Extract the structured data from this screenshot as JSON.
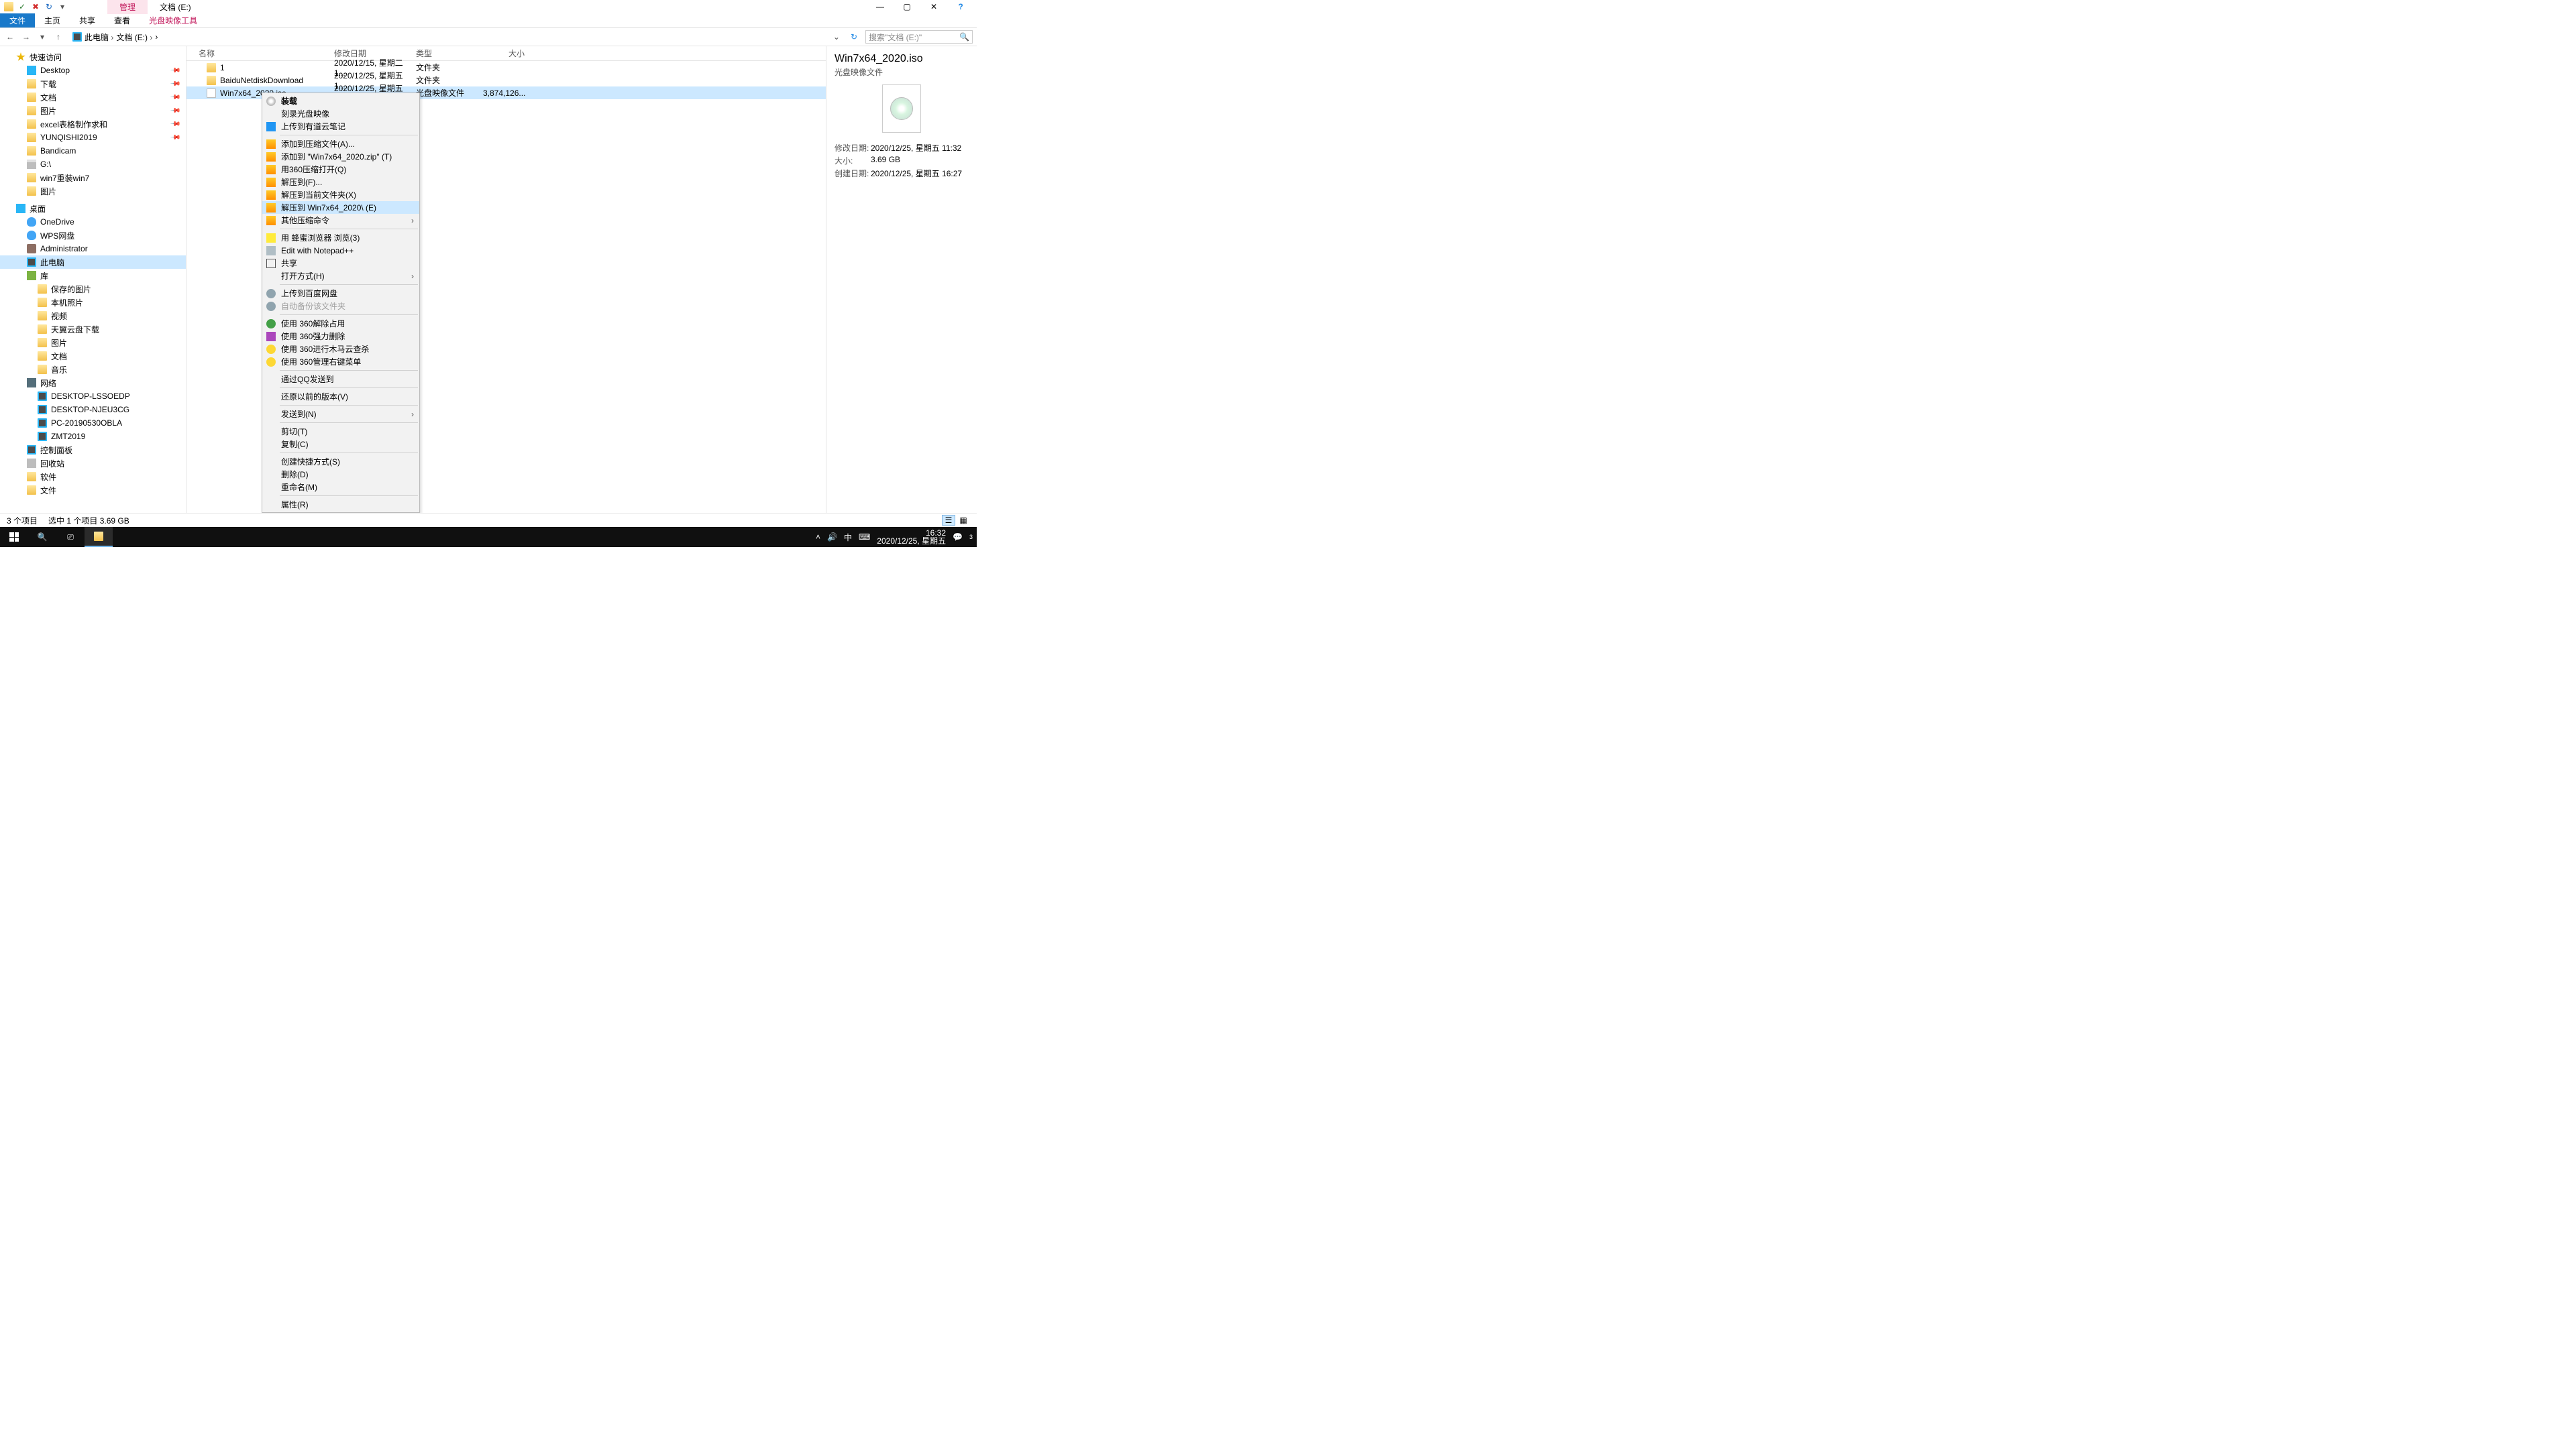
{
  "qat": {
    "save_glyph": "✓",
    "delete_glyph": "✖",
    "redo_glyph": "↻",
    "dd_glyph": "▾"
  },
  "title": {
    "tools_tab": "管理",
    "doc_title": "文档 (E:)"
  },
  "win": {
    "min": "—",
    "max": "▢",
    "close": "✕",
    "help": "?"
  },
  "ribbon": {
    "file": "文件",
    "home": "主页",
    "share": "共享",
    "view": "查看",
    "iso_tools": "光盘映像工具"
  },
  "nav": {
    "back": "←",
    "fwd": "→",
    "dd": "▾",
    "up": "↑",
    "refresh": "↻",
    "addr_dd": "⌄",
    "crumbs": [
      "此电脑",
      "文档 (E:)"
    ],
    "search_ph": "搜索\"文档 (E:)\"",
    "search_glyph": "🔍"
  },
  "sidebar": {
    "quick": "快速访问",
    "q_items": [
      "Desktop",
      "下载",
      "文档",
      "图片",
      "excel表格制作求和",
      "YUNQISHI2019",
      "Bandicam",
      "G:\\",
      "win7重装win7",
      "图片"
    ],
    "desktop_grp": "桌面",
    "d_items": [
      "OneDrive",
      "WPS网盘",
      "Administrator",
      "此电脑",
      "库"
    ],
    "lib_items": [
      "保存的图片",
      "本机照片",
      "视频",
      "天翼云盘下载",
      "图片",
      "文档",
      "音乐"
    ],
    "net": "网络",
    "net_items": [
      "DESKTOP-LSSOEDP",
      "DESKTOP-NJEU3CG",
      "PC-20190530OBLA",
      "ZMT2019"
    ],
    "tail": [
      "控制面板",
      "回收站",
      "软件",
      "文件"
    ]
  },
  "headers": {
    "name": "名称",
    "date": "修改日期",
    "type": "类型",
    "size": "大小"
  },
  "rows": [
    {
      "name": "1",
      "date": "2020/12/15, 星期二 1...",
      "type": "文件夹",
      "size": ""
    },
    {
      "name": "BaiduNetdiskDownload",
      "date": "2020/12/25, 星期五 1...",
      "type": "文件夹",
      "size": ""
    },
    {
      "name": "Win7x64_2020.iso",
      "date": "2020/12/25, 星期五 1...",
      "type": "光盘映像文件",
      "size": "3,874,126..."
    }
  ],
  "ctx": {
    "mount": "装载",
    "burn": "刻录光盘映像",
    "youdao": "上传到有道云笔记",
    "add_arc": "添加到压缩文件(A)...",
    "add_zip": "添加到 \"Win7x64_2020.zip\" (T)",
    "open360": "用360压缩打开(Q)",
    "extract_to": "解压到(F)...",
    "extract_here": "解压到当前文件夹(X)",
    "extract_named": "解压到 Win7x64_2020\\ (E)",
    "other_arc": "其他压缩命令",
    "bee": "用 蜂蜜浏览器 浏览(3)",
    "npp": "Edit with Notepad++",
    "share": "共享",
    "open_with": "打开方式(H)",
    "baidu_up": "上传到百度网盘",
    "baidu_bak": "自动备份该文件夹",
    "s360_unlock": "使用 360解除占用",
    "s360_fdel": "使用 360强力删除",
    "s360_scan": "使用 360进行木马云查杀",
    "s360_mgr": "使用 360管理右键菜单",
    "qq_send": "通过QQ发送到",
    "restore": "还原以前的版本(V)",
    "send_to": "发送到(N)",
    "cut": "剪切(T)",
    "copy": "复制(C)",
    "shortcut": "创建快捷方式(S)",
    "delete": "删除(D)",
    "rename": "重命名(M)",
    "props": "属性(R)",
    "arrow": "›"
  },
  "preview": {
    "title": "Win7x64_2020.iso",
    "subtitle": "光盘映像文件",
    "rows": {
      "mdate_k": "修改日期:",
      "mdate_v": "2020/12/25, 星期五 11:32",
      "size_k": "大小:",
      "size_v": "3.69 GB",
      "cdate_k": "创建日期:",
      "cdate_v": "2020/12/25, 星期五 16:27"
    }
  },
  "status": {
    "count": "3 个项目",
    "selected": "选中 1 个项目  3.69 GB"
  },
  "taskbar": {
    "tray_chevron": "˄",
    "tray_vol": "🔊",
    "tray_ime": "中",
    "tray_kb": "⌨",
    "tray_bubble": "💬",
    "badge": "3",
    "time": "16:32",
    "date": "2020/12/25, 星期五"
  }
}
